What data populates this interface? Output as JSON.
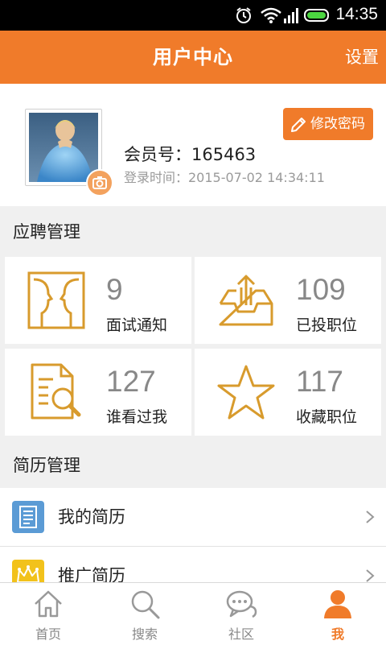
{
  "status_bar": {
    "time": "14:35",
    "icons": [
      "alarm-icon",
      "wifi-icon",
      "signal-icon",
      "battery-icon"
    ]
  },
  "header": {
    "title": "用户中心",
    "settings_label": "设置",
    "background": "#f07b2a"
  },
  "profile": {
    "change_password_label": "修改密码",
    "member_label": "会员号：165463",
    "login_time_label": "登录时间：2015-07-02 14:34:11"
  },
  "recruit": {
    "section_title": "应聘管理",
    "cards": [
      {
        "count": "9",
        "label": "面试通知",
        "icon": "interview-faces-icon"
      },
      {
        "count": "109",
        "label": "已投职位",
        "icon": "tray-upload-icon"
      },
      {
        "count": "127",
        "label": "谁看过我",
        "icon": "document-magnifier-icon"
      },
      {
        "count": "117",
        "label": "收藏职位",
        "icon": "star-icon"
      }
    ]
  },
  "resume": {
    "section_title": "简历管理",
    "items": [
      {
        "label": "我的简历",
        "icon": "resume-document-icon"
      },
      {
        "label": "推广简历",
        "icon": "crown-icon"
      }
    ]
  },
  "tabbar": {
    "tabs": [
      {
        "label": "首页",
        "icon": "home-icon"
      },
      {
        "label": "搜索",
        "icon": "search-icon"
      },
      {
        "label": "社区",
        "icon": "chat-bubbles-icon"
      },
      {
        "label": "我",
        "icon": "person-icon"
      }
    ],
    "active_index": 3,
    "active_color": "#f07b2a"
  }
}
